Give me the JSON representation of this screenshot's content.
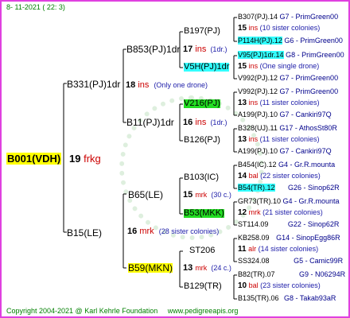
{
  "header": {
    "date": "8- 11-2021 ( 22: 3)"
  },
  "footer": {
    "copyright": "Copyright 2004-2021 @ Karl Kehrle Foundation",
    "site": "www.pedigreeapis.org"
  },
  "root": {
    "name": "B001(VDH)",
    "gen": "19",
    "gen_label": "frkg"
  },
  "gen1": [
    {
      "name": "B331(PJ)1dr",
      "gen": "18",
      "gen_label": "ins",
      "note": "(Only one drone)"
    },
    {
      "name": "B15(LE)",
      "gen": "16",
      "gen_label": "mrk",
      "note": "(28 sister colonies)"
    }
  ],
  "gen2": [
    {
      "name": "B853(PJ)1dr",
      "gen": "17",
      "gen_label": "ins",
      "note": "(1dr.)"
    },
    {
      "name": "B11(PJ)1dr",
      "gen": "16",
      "gen_label": "ins",
      "note": "(1dr.)"
    },
    {
      "name": "B65(LE)",
      "gen": "15",
      "gen_label": "mrk",
      "note": "(30 c.)"
    },
    {
      "name": "B59(MKN)",
      "gen": "13",
      "gen_label": "mrk",
      "note": "(24 c.)"
    }
  ],
  "gen3": [
    {
      "name": "B197(PJ)"
    },
    {
      "name": "V5H(PJ)1dr"
    },
    {
      "name": "V216(PJ)"
    },
    {
      "name": "B126(PJ)"
    },
    {
      "name": "B103(IC)"
    },
    {
      "name": "B53(MKK)"
    },
    {
      "name": "ST206"
    },
    {
      "name": "B129(TR)"
    }
  ],
  "gen4": [
    {
      "line1": "B307(PJ).14",
      "ref": "G7 - PrimGreen00",
      "gen": "15",
      "gen_label": "ins",
      "note": "(10 sister colonies)"
    },
    {
      "line1": "P114H(PJ).12",
      "ref": "G6 - PrimGreen00",
      "gen": "15",
      "gen_label": "ins",
      "note": "(One single drone)",
      "alt": "V95(PJ)1dr.14",
      "alt_ref": "G8 - PrimGreen00"
    },
    {
      "line1": "V992(PJ).12",
      "ref": "G7 - PrimGreen00",
      "gen": "",
      "gen_label": "",
      "note": ""
    },
    {
      "line1": "V992(PJ).12",
      "ref": "G7 - PrimGreen00",
      "gen": "13",
      "gen_label": "ins",
      "note": "(11 sister colonies)",
      "alt": "A199(PJ).10",
      "alt_ref": "G7 - Cankiri97Q"
    },
    {
      "line1": "B328(UJ).11",
      "ref": "G17 - AthosSt80R",
      "gen": "13",
      "gen_label": "ins",
      "note": "(11 sister colonies)",
      "alt": "A199(PJ).10",
      "alt_ref": "G7 - Cankiri97Q"
    },
    {
      "line1": "B454(IC).12",
      "ref": "G4 - Gr.R.mounta",
      "gen": "14",
      "gen_label": "bal",
      "note": "(22 sister colonies)",
      "alt": "B54(TR).12",
      "alt_ref": "G26 - Sinop62R"
    },
    {
      "line1": "GR73(TR).10",
      "ref": "G4 - Gr.R.mounta",
      "gen": "12",
      "gen_label": "mrk",
      "note": "(21 sister colonies)",
      "alt": "ST114.09",
      "alt_ref": "G22 - Sinop62R"
    },
    {
      "line1": "KB258.09",
      "ref": "G14 - SinopEgg86R",
      "gen": "11",
      "gen_label": "alr",
      "note": "(14 sister colonies)",
      "alt": "SS324.08",
      "alt_ref": "G5 - Camic99R"
    },
    {
      "line1": "B82(TR).07",
      "ref": "G9 - N06294R",
      "gen": "10",
      "gen_label": "bal",
      "note": "(23 sister colonies)",
      "alt": "B135(TR).06",
      "alt_ref": "G8 - Takab93aR"
    }
  ]
}
